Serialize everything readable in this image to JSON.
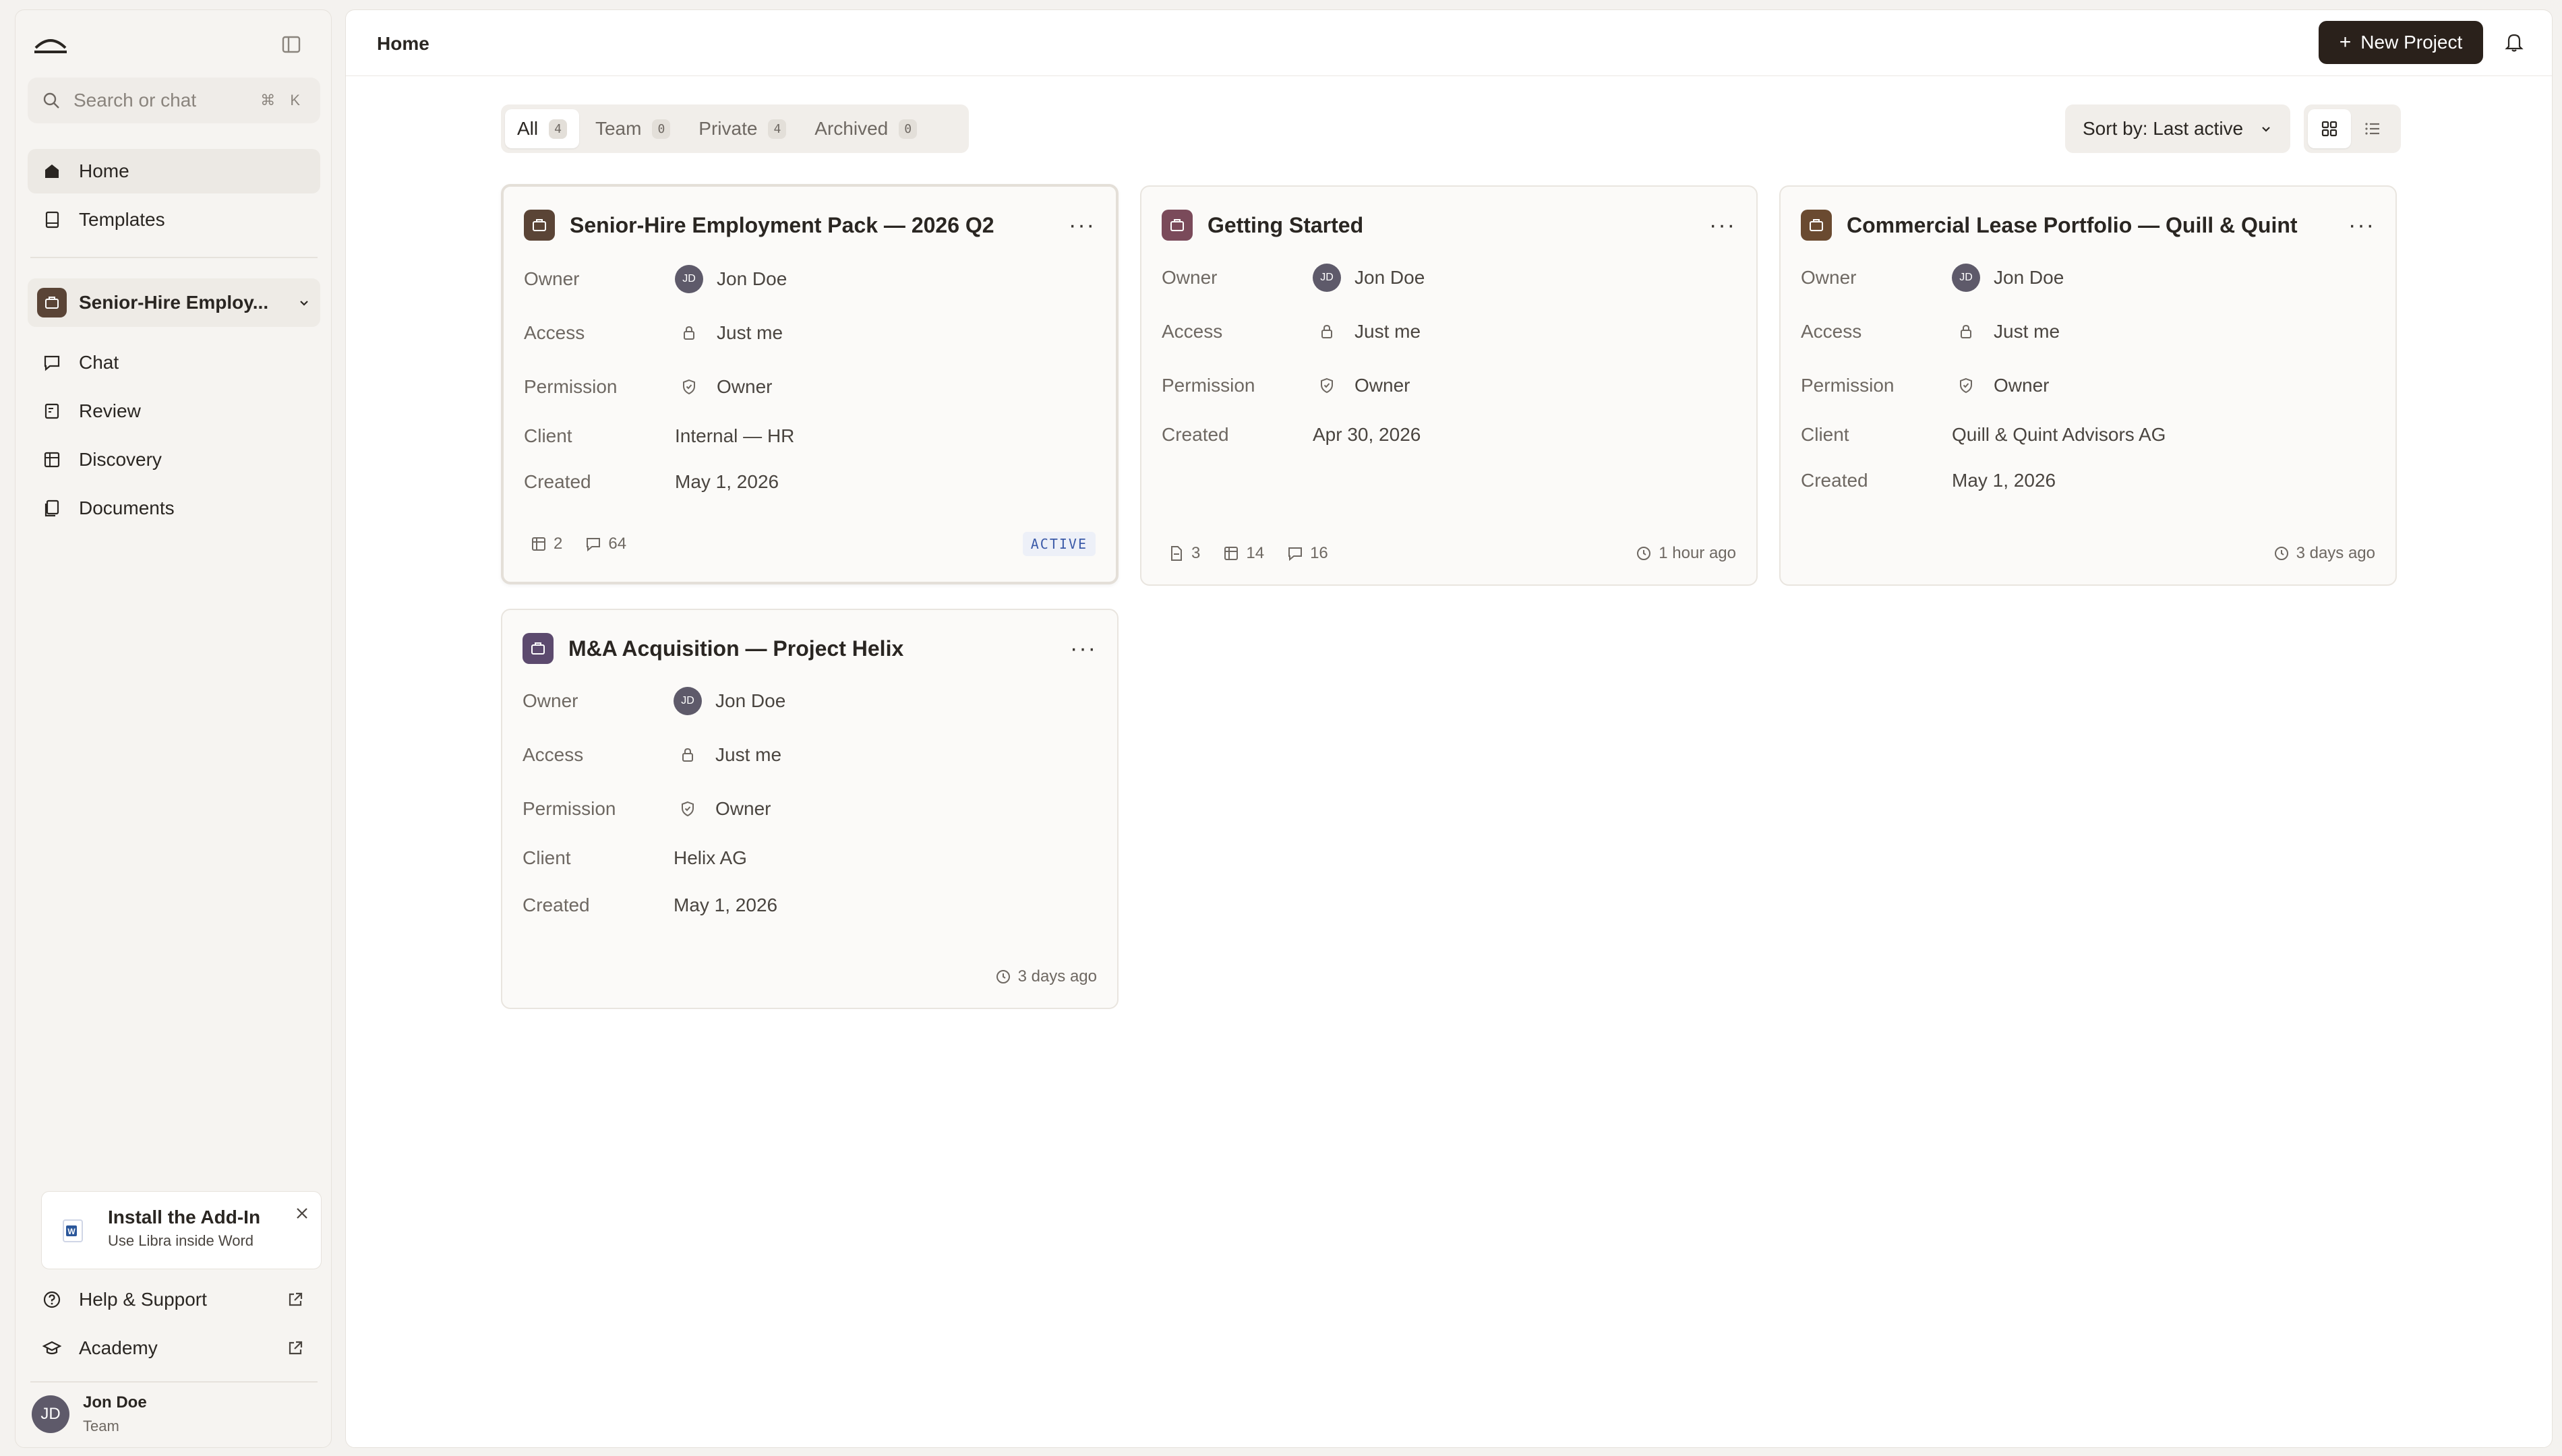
{
  "sidebar": {
    "search_placeholder": "Search or chat",
    "search_shortcut": "⌘ K",
    "nav": [
      {
        "label": "Home",
        "icon": "home-icon",
        "active": true
      },
      {
        "label": "Templates",
        "icon": "book-icon",
        "active": false
      }
    ],
    "project_switcher": "Senior-Hire Employ...",
    "project_nav": [
      {
        "label": "Chat",
        "icon": "chat-icon"
      },
      {
        "label": "Review",
        "icon": "review-icon"
      },
      {
        "label": "Discovery",
        "icon": "table-icon"
      },
      {
        "label": "Documents",
        "icon": "documents-icon"
      }
    ],
    "addin": {
      "title": "Install the Add-In",
      "subtitle": "Use Libra inside Word"
    },
    "footer_links": [
      {
        "label": "Help & Support",
        "icon": "help-icon"
      },
      {
        "label": "Academy",
        "icon": "academy-icon"
      }
    ],
    "user": {
      "initials": "JD",
      "name": "Jon Doe",
      "team": "Team"
    }
  },
  "header": {
    "breadcrumb": "Home",
    "new_project_label": "New Project"
  },
  "toolbar": {
    "tabs": [
      {
        "label": "All",
        "count": "4",
        "active": true
      },
      {
        "label": "Team",
        "count": "0",
        "active": false
      },
      {
        "label": "Private",
        "count": "4",
        "active": false
      },
      {
        "label": "Archived",
        "count": "0",
        "active": false
      }
    ],
    "sort_label": "Sort by: Last active",
    "view_mode": "grid"
  },
  "labels": {
    "owner": "Owner",
    "access": "Access",
    "permission": "Permission",
    "client": "Client",
    "created": "Created"
  },
  "projects": [
    {
      "title": "Senior-Hire Employment Pack — 2026 Q2",
      "owner_initials": "JD",
      "owner": "Jon Doe",
      "access": "Just me",
      "permission": "Owner",
      "client": "Internal — HR",
      "created": "May 1, 2026",
      "tables": "2",
      "chats": "64",
      "status": "ACTIVE",
      "icon_color": "#5a4436"
    },
    {
      "title": "Getting Started",
      "owner_initials": "JD",
      "owner": "Jon Doe",
      "access": "Just me",
      "permission": "Owner",
      "created": "Apr 30, 2026",
      "docs": "3",
      "tables": "14",
      "chats": "16",
      "last_active": "1 hour ago",
      "icon_color": "#7a4a5a"
    },
    {
      "title": "Commercial Lease Portfolio — Quill & Quint",
      "owner_initials": "JD",
      "owner": "Jon Doe",
      "access": "Just me",
      "permission": "Owner",
      "client": "Quill & Quint Advisors AG",
      "created": "May 1, 2026",
      "last_active": "3 days ago",
      "icon_color": "#6a4a30"
    },
    {
      "title": "M&A Acquisition — Project Helix",
      "owner_initials": "JD",
      "owner": "Jon Doe",
      "access": "Just me",
      "permission": "Owner",
      "client": "Helix AG",
      "created": "May 1, 2026",
      "last_active": "3 days ago",
      "icon_color": "#5c4a6e"
    }
  ]
}
